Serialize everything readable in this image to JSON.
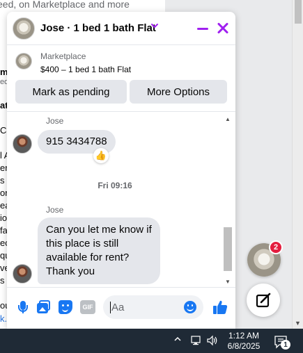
{
  "background_page": {
    "top_text": "eed, on Marketplace and more",
    "left_fragments": [
      "m",
      "ed",
      "at",
      "Ca",
      "l A",
      "er",
      "s a",
      "on",
      "ea",
      "io",
      "fa",
      "ec",
      "qu",
      "ve",
      "s",
      "ou",
      "k."
    ]
  },
  "chat": {
    "title": "Jose · 1 bed 1 bath Flat",
    "listing": {
      "source": "Marketplace",
      "title": "$400 – 1 bed 1 bath Flat"
    },
    "buttons": {
      "mark_pending": "Mark as pending",
      "more_options": "More Options"
    },
    "messages": [
      {
        "sender": "Jose",
        "text": "915 3434788",
        "reaction": "👍"
      },
      {
        "sender": "Jose",
        "text": "Can you let me know if this place is still available for rent? Thank you"
      }
    ],
    "timestamp": "Fri 09:16",
    "composer": {
      "placeholder": "Aa",
      "gif_label": "GIF"
    }
  },
  "floating": {
    "badge_count": "2"
  },
  "taskbar": {
    "time": "1:12 AM",
    "date": "6/8/2025",
    "notification_count": "1"
  },
  "colors": {
    "accent_purple": "#a020f0",
    "messenger_blue": "#1877f2",
    "badge_red": "#e41e3f",
    "bubble_gray": "#e4e6eb",
    "taskbar": "#1f2a36"
  }
}
